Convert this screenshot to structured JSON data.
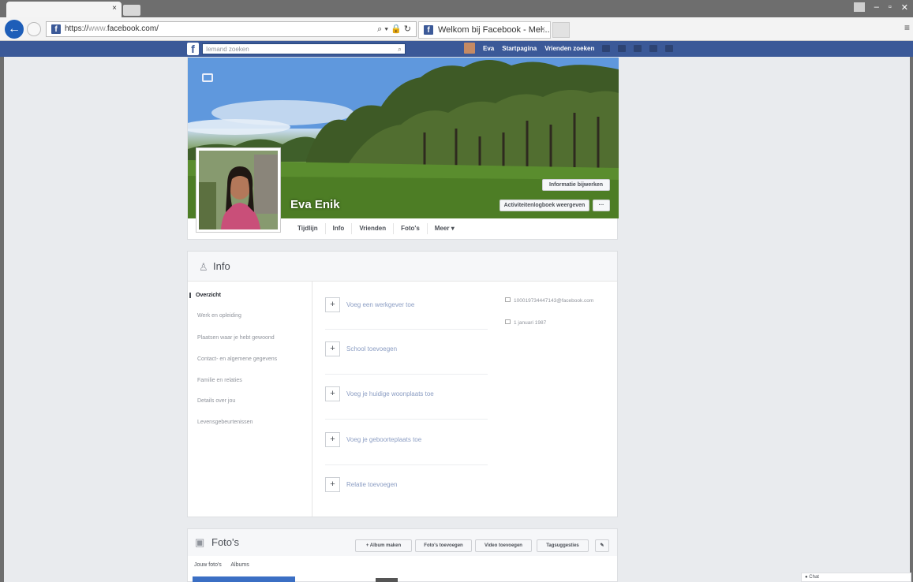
{
  "browser": {
    "url_prefix": "https://",
    "url_dim": "www.",
    "url_host": "facebook.com/",
    "tab_title": "Welkom bij Facebook - Mel...",
    "tab_close": "×",
    "left_tab_close": "×",
    "url_tools": "⌕ ▾ 🔒 ↻",
    "window_controls": [
      "–",
      "▫",
      "✕"
    ],
    "scroll_glyph": "≡"
  },
  "fb_nav": {
    "logo": "f",
    "search_placeholder": "Iemand zoeken",
    "search_icon": "⌕",
    "user_name": "Eva",
    "pages_label": "Startpagina",
    "find_friends_label": "Vrienden zoeken"
  },
  "profile": {
    "name": "Eva Enik",
    "update_info_label": "Informatie bijwerken",
    "activity_log_label": "Activiteitenlogboek weergeven",
    "more_dots": "···",
    "tabs": [
      "Tijdlijn",
      "Info",
      "Vrienden",
      "Foto's",
      "Meer ▾"
    ]
  },
  "info": {
    "title": "Info",
    "icon": "♙",
    "menu": [
      "Overzicht",
      "Werk en opleiding",
      "Plaatsen waar je hebt gewoond",
      "Contact- en algemene gegevens",
      "Familie en relaties",
      "Details over jou",
      "Levensgebeurtenissen"
    ],
    "add_items": [
      "Voeg een werkgever toe",
      "School toevoegen",
      "Voeg je huidige woonplaats toe",
      "Voeg je geboorteplaats toe",
      "Relatie toevoegen"
    ],
    "plus": "+",
    "contact_email": "100019734447143@facebook.com",
    "contact_birthday": "1 januari 1987"
  },
  "photos": {
    "title": "Foto's",
    "icon": "▣",
    "buttons": [
      "+ Album maken",
      "Foto's toevoegen",
      "Video toevoegen",
      "Tagsuggesties",
      "✎"
    ],
    "tabs": [
      "Jouw foto's",
      "Albums"
    ]
  },
  "chat": {
    "label": "Chat"
  },
  "colors": {
    "facebook_blue": "#3b5998",
    "page_bg": "#e9ebee"
  }
}
